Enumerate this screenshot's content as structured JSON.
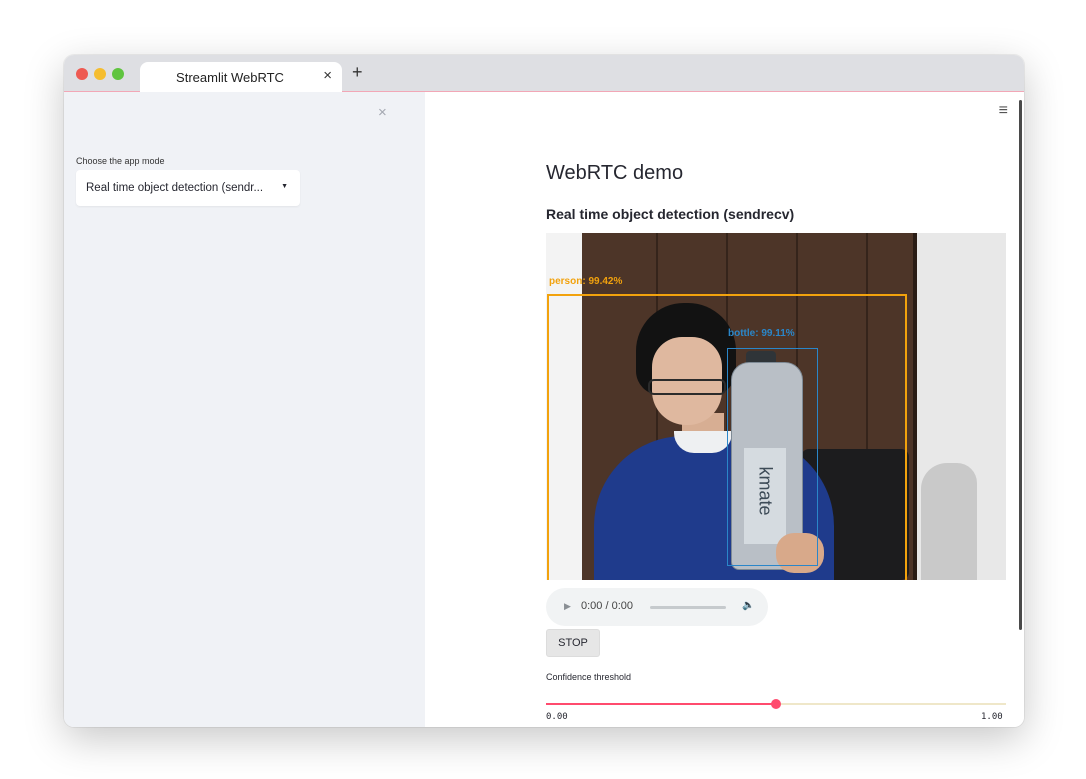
{
  "browser": {
    "tab_title": "Streamlit WebRTC",
    "tab_close_icon": "×",
    "new_tab_icon": "+"
  },
  "sidebar": {
    "close_icon": "×",
    "mode_label": "Choose the app mode",
    "mode_value": "Real time object detection (sendr...",
    "caret": "▼"
  },
  "main": {
    "menu_icon": "≡",
    "title": "WebRTC demo",
    "subheader": "Real time object detection (sendrecv)",
    "video": {
      "detections": [
        {
          "label": "person: 99.42%",
          "color": "#f2a20d"
        },
        {
          "label": "bottle: 99.11%",
          "color": "#2a86c9"
        }
      ],
      "bottle_text": "kmate"
    },
    "audio": {
      "play_icon": "▶",
      "time": "0:00 / 0:00",
      "volume_icon": "🔈"
    },
    "stop_label": "STOP",
    "slider": {
      "label": "Confidence threshold",
      "value": 0.5,
      "min_label": "0.00",
      "max_label": "1.00",
      "accent": "#ff4b6e"
    }
  }
}
